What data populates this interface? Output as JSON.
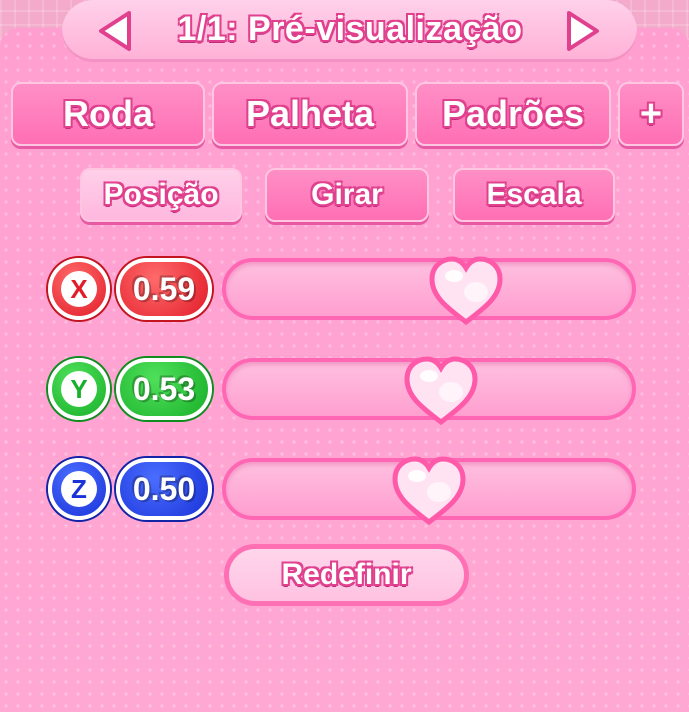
{
  "header": {
    "title": "1/1: Pré-visualização"
  },
  "tabs": [
    {
      "label": "Roda"
    },
    {
      "label": "Palheta"
    },
    {
      "label": "Padrões"
    },
    {
      "label": "+"
    }
  ],
  "subtabs": [
    {
      "label": "Posição",
      "selected": true
    },
    {
      "label": "Girar",
      "selected": false
    },
    {
      "label": "Escala",
      "selected": false
    }
  ],
  "axes": [
    {
      "axis": "X",
      "value": "0.59",
      "slider_fraction": 0.59,
      "color": "#e21d2a"
    },
    {
      "axis": "Y",
      "value": "0.53",
      "slider_fraction": 0.53,
      "color": "#19b02a"
    },
    {
      "axis": "Z",
      "value": "0.50",
      "slider_fraction": 0.5,
      "color": "#1a33d8"
    }
  ],
  "reset_label": "Redefinir",
  "icons": {
    "prev": "arrow-left-icon",
    "next": "arrow-right-icon",
    "thumb": "heart-icon"
  },
  "colors": {
    "accent": "#ff6fb4",
    "panel": "#ffa8d4"
  }
}
